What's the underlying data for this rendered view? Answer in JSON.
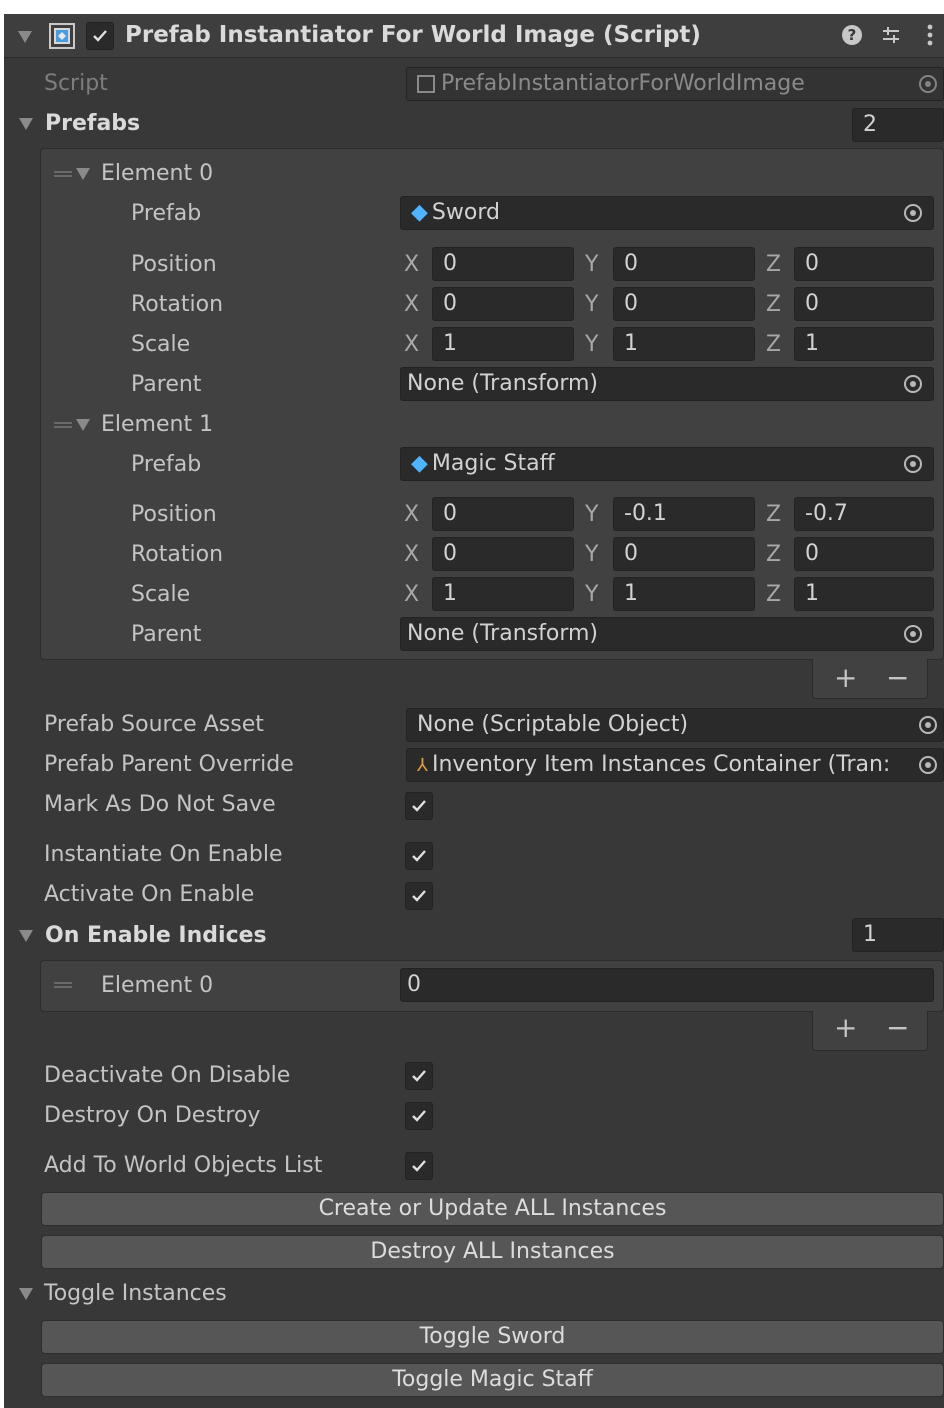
{
  "header": {
    "title": "Prefab Instantiator For World Image (Script)",
    "enabled": true,
    "help_icon": "help-icon",
    "presets_icon": "presets-icon",
    "menu_icon": "kebab-menu-icon"
  },
  "script": {
    "label": "Script",
    "value": "PrefabInstantiatorForWorldImage"
  },
  "prefabs": {
    "label": "Prefabs",
    "size": "2",
    "elements": [
      {
        "label": "Element 0",
        "prefab_label": "Prefab",
        "prefab_value": "Sword",
        "position_label": "Position",
        "position": {
          "x": "0",
          "y": "0",
          "z": "0"
        },
        "rotation_label": "Rotation",
        "rotation": {
          "x": "0",
          "y": "0",
          "z": "0"
        },
        "scale_label": "Scale",
        "scale": {
          "x": "1",
          "y": "1",
          "z": "1"
        },
        "parent_label": "Parent",
        "parent_value": "None (Transform)"
      },
      {
        "label": "Element 1",
        "prefab_label": "Prefab",
        "prefab_value": "Magic Staff",
        "position_label": "Position",
        "position": {
          "x": "0",
          "y": "-0.1",
          "z": "-0.7"
        },
        "rotation_label": "Rotation",
        "rotation": {
          "x": "0",
          "y": "0",
          "z": "0"
        },
        "scale_label": "Scale",
        "scale": {
          "x": "1",
          "y": "1",
          "z": "1"
        },
        "parent_label": "Parent",
        "parent_value": "None (Transform)"
      }
    ]
  },
  "axis": {
    "x": "X",
    "y": "Y",
    "z": "Z"
  },
  "list_add": "+",
  "list_remove": "−",
  "prefab_source_asset": {
    "label": "Prefab Source Asset",
    "value": "None (Scriptable Object)"
  },
  "prefab_parent_override": {
    "label": "Prefab Parent Override",
    "value": "Inventory Item Instances Container (Tran:"
  },
  "mark_as_do_not_save": {
    "label": "Mark As Do Not Save",
    "checked": true
  },
  "instantiate_on_enable": {
    "label": "Instantiate On Enable",
    "checked": true
  },
  "activate_on_enable": {
    "label": "Activate On Enable",
    "checked": true
  },
  "on_enable_indices": {
    "label": "On Enable Indices",
    "size": "1",
    "element_label": "Element 0",
    "element_value": "0"
  },
  "deactivate_on_disable": {
    "label": "Deactivate On Disable",
    "checked": true
  },
  "destroy_on_destroy": {
    "label": "Destroy On Destroy",
    "checked": true
  },
  "add_to_world_objects_list": {
    "label": "Add To World Objects List",
    "checked": true
  },
  "buttons": {
    "create_update": "Create or Update ALL Instances",
    "destroy_all": "Destroy ALL Instances"
  },
  "toggle_instances": {
    "label": "Toggle Instances",
    "toggle_sword": "Toggle Sword",
    "toggle_magic_staff": "Toggle Magic Staff"
  },
  "colors": {
    "panel_bg": "#383838",
    "field_bg": "#2a2a2a",
    "button_bg": "#565656",
    "prefab_icon": "#4fb3ff"
  }
}
